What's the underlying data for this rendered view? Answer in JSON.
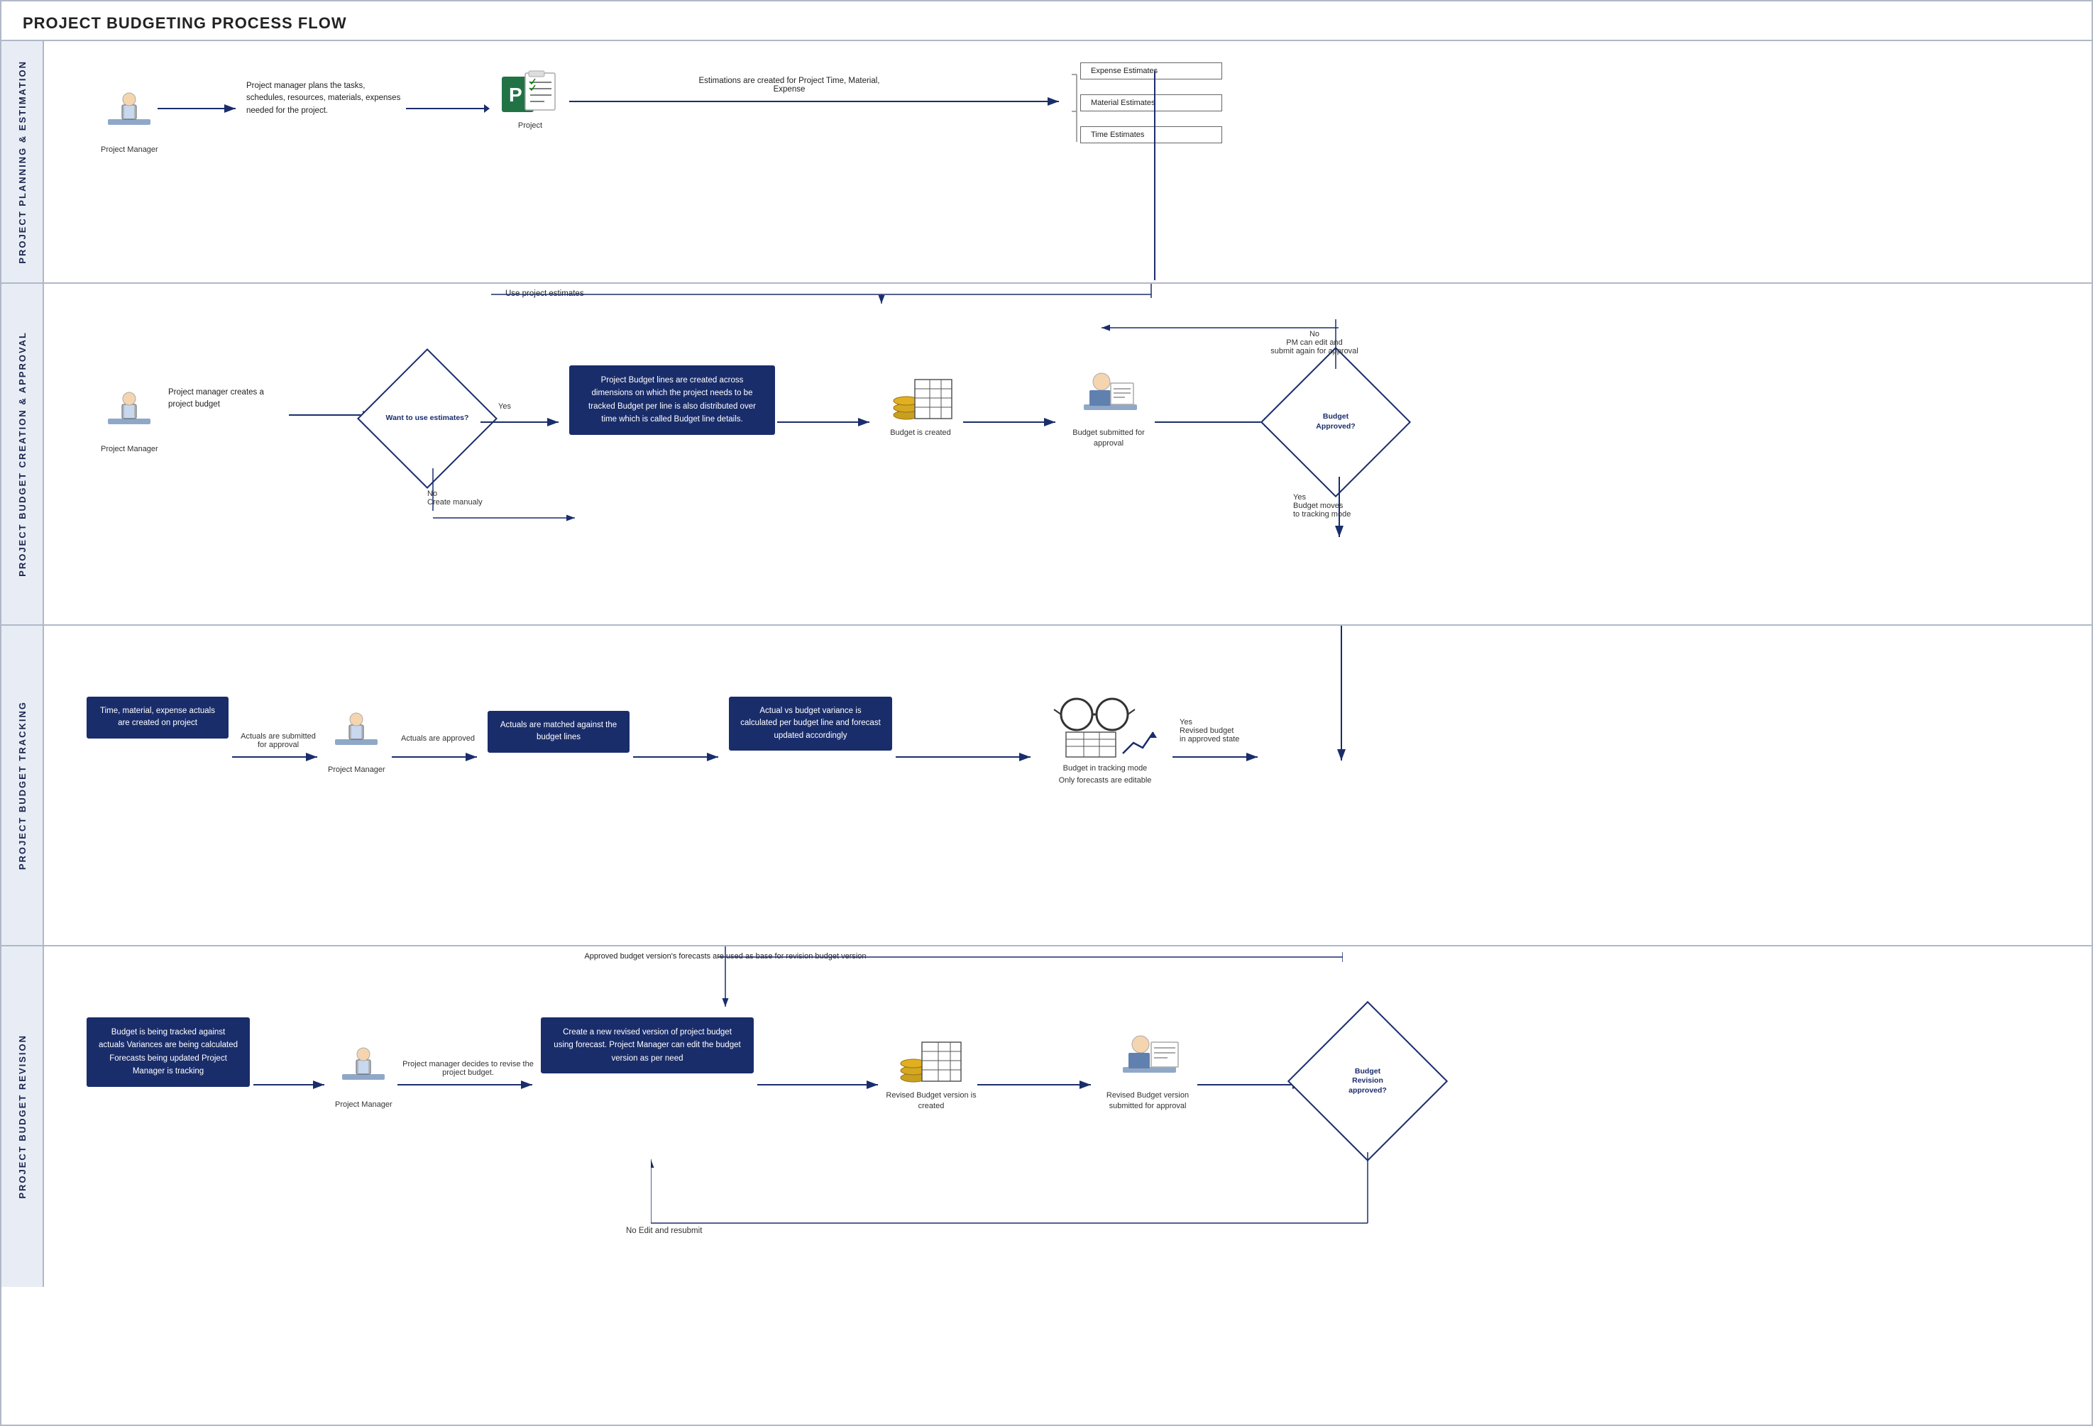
{
  "title": "PROJECT BUDGETING PROCESS FLOW",
  "lanes": [
    {
      "id": "lane-planning",
      "label": "PROJECT PLANNING & ESTIMATION"
    },
    {
      "id": "lane-creation",
      "label": "PROJECT BUDGET CREATION & APPROVAL"
    },
    {
      "id": "lane-tracking",
      "label": "PROJECT BUDGET TRACKING"
    },
    {
      "id": "lane-revision",
      "label": "PROJECT BUDGET REVISION"
    }
  ],
  "lane1": {
    "pm_label": "Project Manager",
    "pm_desc": "Project manager plans the tasks, schedules, resources, materials, expenses needed for the project.",
    "project_label": "Project",
    "arrow1": "Estimations are created for Project Time, Material, Expense",
    "expense_est": "Expense Estimates",
    "material_est": "Material Estimates",
    "time_est": "Time Estimates"
  },
  "lane2": {
    "pm_label": "Project Manager",
    "pm_desc": "Project manager creates a project budget",
    "diamond1": "Want to use estimates?",
    "yes_label": "Yes",
    "no_label": "No\nCreate manualy",
    "budget_lines_box": "Project Budget lines are created across dimensions on which the project needs to be tracked\nBudget per line is also distributed over time which is called Budget line details.",
    "budget_created_label": "Budget is created",
    "budget_submitted_label": "Budget submitted for approval",
    "diamond2": "Budget Approved?",
    "no_edit_label": "No\nPM can edit and submit again for approval",
    "yes_move_label": "Yes\nBudget moves to tracking mode",
    "use_estimates_label": "Use project estimates"
  },
  "lane3": {
    "box1": "Time, material, expense actuals are created on project",
    "arrow1": "Actuals are submitted for approval",
    "pm_label": "Project Manager",
    "arrow2": "Actuals are approved",
    "box2": "Actuals are matched against the budget lines",
    "box3": "Actual vs budget variance is calculated per budget line and forecast updated accordingly",
    "budget_tracking_label": "Budget in tracking mode\nOnly forecasts are editable",
    "yes_label": "Yes\nRevised budget in approved state"
  },
  "lane4": {
    "box1": "Budget is being tracked against actuals\nVariances are being calculated\nForecasts being updated\nProject Manager is tracking",
    "pm_label": "Project Manager",
    "arrow1": "Project manager decides to revise the project budget.",
    "box2": "Create a new revised version of project budget using forecast.\nProject Manager can edit the budget version as per need",
    "revised_created_label": "Revised Budget version is created",
    "revised_submitted_label": "Revised Budget version submitted for approval",
    "diamond": "Budget Revision approved?",
    "no_edit_label": "No Edit and resubmit",
    "approved_forecasts_label": "Approved budget version's forecasts are used as base for revision budget version"
  },
  "colors": {
    "dark_blue": "#1a2d6b",
    "mid_blue": "#2e4fa3",
    "border": "#b0b8c8",
    "lane_bg": "#e8edf5"
  }
}
